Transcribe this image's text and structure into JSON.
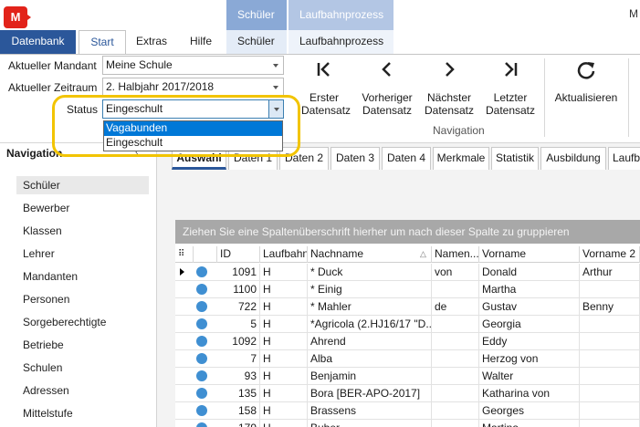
{
  "app": {
    "logo": "M",
    "title_fragment": "M"
  },
  "tabs": {
    "datenbank": "Datenbank",
    "start": "Start",
    "extras": "Extras",
    "hilfe": "Hilfe",
    "context_schueler_group": "Schüler",
    "context_laufbahn_group": "Laufbahnprozess",
    "context_schueler": "Schüler",
    "context_laufbahn": "Laufbahnprozess"
  },
  "ribbon": {
    "mandant_label": "Aktueller Mandant",
    "mandant_value": "Meine Schule",
    "zeitraum_label": "Aktueller Zeitraum",
    "zeitraum_value": "2. Halbjahr 2017/2018",
    "status_label": "Status",
    "status_value": "Eingeschult",
    "status_options": [
      "Vagabunden",
      "Eingeschult"
    ],
    "nav_buttons": [
      {
        "icon": "first-record-icon",
        "line1": "Erster",
        "line2": "Datensatz"
      },
      {
        "icon": "previous-record-icon",
        "line1": "Vorheriger",
        "line2": "Datensatz"
      },
      {
        "icon": "next-record-icon",
        "line1": "Nächster",
        "line2": "Datensatz"
      },
      {
        "icon": "last-record-icon",
        "line1": "Letzter",
        "line2": "Datensatz"
      }
    ],
    "refresh_label": "Aktualisieren",
    "group_label": "Navigation"
  },
  "navigation": {
    "title": "Navigation",
    "pin": "‹",
    "items": [
      "Schüler",
      "Bewerber",
      "Klassen",
      "Lehrer",
      "Mandanten",
      "Personen",
      "Sorgeberechtigte",
      "Betriebe",
      "Schulen",
      "Adressen",
      "Mittelstufe"
    ]
  },
  "data_tabs": [
    "Auswahl",
    "Daten 1",
    "Daten 2",
    "Daten 3",
    "Daten 4",
    "Merkmale",
    "Statistik",
    "Ausbildung",
    "Laufba"
  ],
  "grid": {
    "group_hint": "Ziehen Sie eine Spaltenüberschrift hierher um nach dieser Spalte zu gruppieren",
    "columns": [
      "ID",
      "Laufbahn",
      "Nachname",
      "Namen...",
      "Vorname",
      "Vorname 2"
    ],
    "rows": [
      {
        "id": "1091",
        "laufbahn": "H",
        "nachname": "* Duck",
        "namen": "von",
        "vorname": "Donald",
        "vorname2": "Arthur"
      },
      {
        "id": "1100",
        "laufbahn": "H",
        "nachname": "* Einig",
        "namen": "",
        "vorname": "Martha",
        "vorname2": ""
      },
      {
        "id": "722",
        "laufbahn": "H",
        "nachname": "* Mahler",
        "namen": "de",
        "vorname": "Gustav",
        "vorname2": "Benny"
      },
      {
        "id": "5",
        "laufbahn": "H",
        "nachname": "*Agricola (2.HJ16/17 \"D...",
        "namen": "",
        "vorname": "Georgia",
        "vorname2": ""
      },
      {
        "id": "1092",
        "laufbahn": "H",
        "nachname": "Ahrend",
        "namen": "",
        "vorname": "Eddy",
        "vorname2": ""
      },
      {
        "id": "7",
        "laufbahn": "H",
        "nachname": "Alba",
        "namen": "",
        "vorname": "Herzog von",
        "vorname2": ""
      },
      {
        "id": "93",
        "laufbahn": "H",
        "nachname": "Benjamin",
        "namen": "",
        "vorname": "Walter",
        "vorname2": ""
      },
      {
        "id": "135",
        "laufbahn": "H",
        "nachname": "Bora [BER-APO-2017]",
        "namen": "",
        "vorname": "Katharina von",
        "vorname2": ""
      },
      {
        "id": "158",
        "laufbahn": "H",
        "nachname": "Brassens",
        "namen": "",
        "vorname": "Georges",
        "vorname2": ""
      },
      {
        "id": "179",
        "laufbahn": "H",
        "nachname": "Buber",
        "namen": "",
        "vorname": "Martina",
        "vorname2": ""
      }
    ]
  },
  "colors": {
    "accent": "#2b579a",
    "highlight": "#f2c400",
    "selection": "#0078d7",
    "status_dot": "#3f8fd2"
  }
}
